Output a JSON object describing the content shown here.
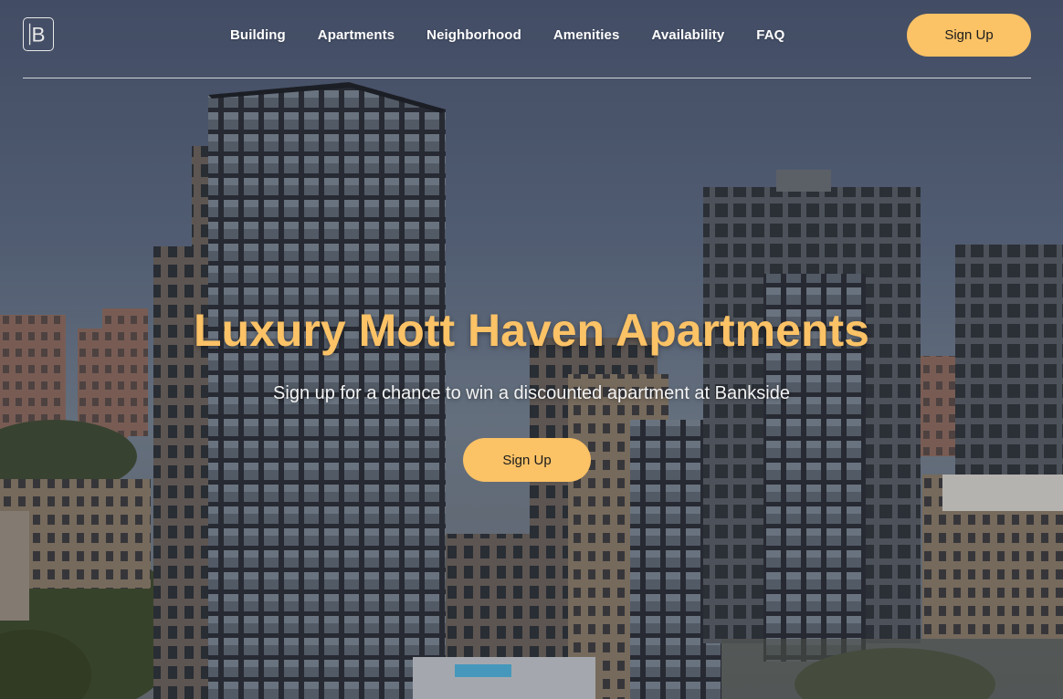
{
  "brand": {
    "logo_letter": "B",
    "accent_color": "#fbc266"
  },
  "nav": {
    "items": [
      {
        "label": "Building"
      },
      {
        "label": "Apartments"
      },
      {
        "label": "Neighborhood"
      },
      {
        "label": "Amenities"
      },
      {
        "label": "Availability"
      },
      {
        "label": "FAQ"
      }
    ]
  },
  "header": {
    "signup_label": "Sign Up"
  },
  "hero": {
    "title": "Luxury Mott Haven Apartments",
    "subtitle": "Sign up for a chance to win a discounted apartment at Bankside",
    "cta_label": "Sign Up"
  }
}
